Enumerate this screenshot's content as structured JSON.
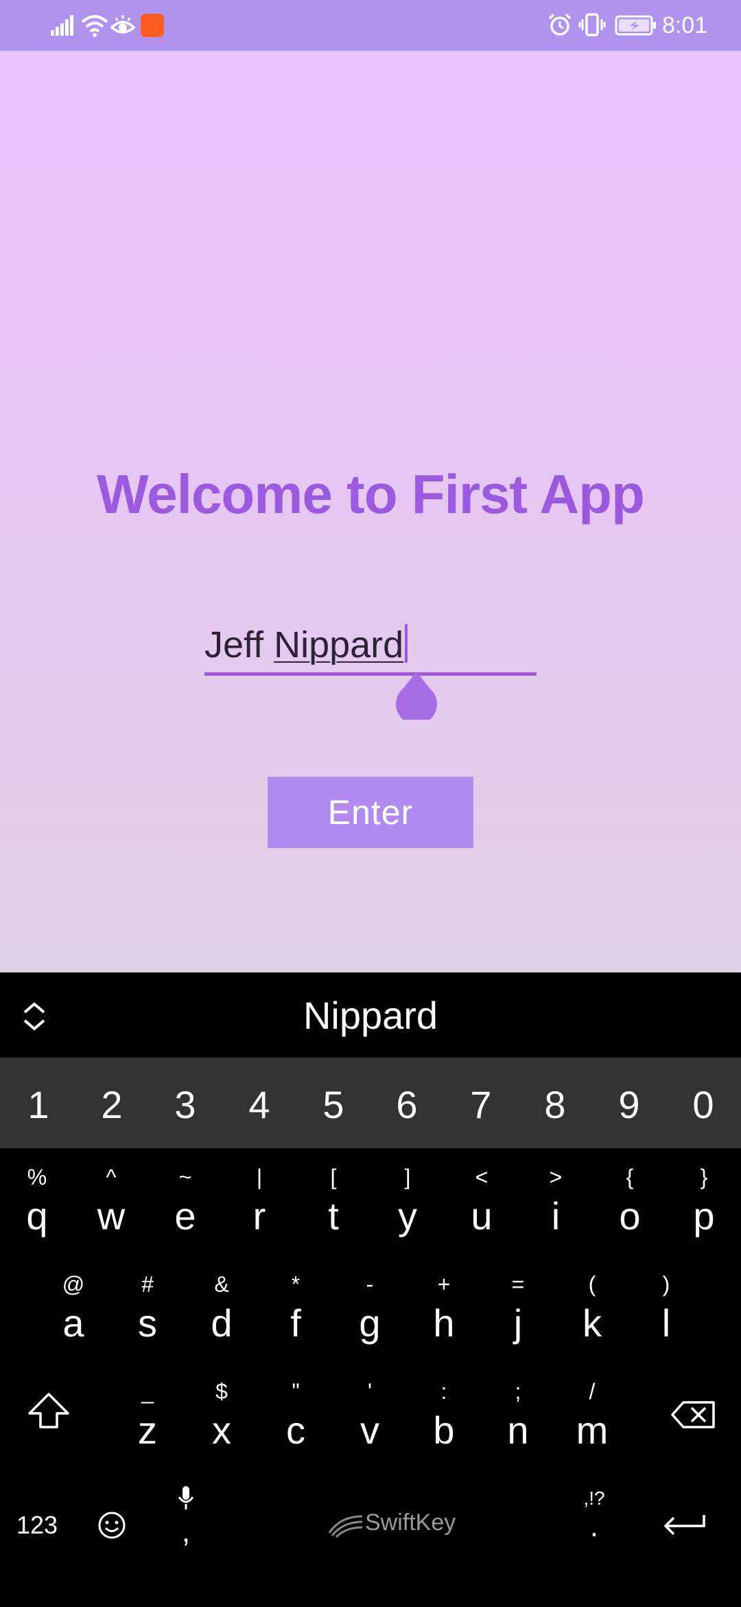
{
  "status_bar": {
    "time": "8:01",
    "icons": [
      "signal-icon",
      "wifi-icon",
      "eye-comfort-icon",
      "notification-app-icon",
      "alarm-icon",
      "vibrate-icon",
      "battery-charging-icon"
    ]
  },
  "app": {
    "title": "Welcome to First App",
    "name_input": {
      "value_first": "Jeff ",
      "value_last": "Nippard"
    },
    "enter_button": "Enter",
    "accent_color": "#9a5ae0",
    "button_color": "#b08cf2"
  },
  "keyboard": {
    "suggestion": "Nippard",
    "numbers": [
      "1",
      "2",
      "3",
      "4",
      "5",
      "6",
      "7",
      "8",
      "9",
      "0"
    ],
    "row1": [
      {
        "key": "q",
        "alt": "%"
      },
      {
        "key": "w",
        "alt": "^"
      },
      {
        "key": "e",
        "alt": "~"
      },
      {
        "key": "r",
        "alt": "|"
      },
      {
        "key": "t",
        "alt": "["
      },
      {
        "key": "y",
        "alt": "]"
      },
      {
        "key": "u",
        "alt": "<"
      },
      {
        "key": "i",
        "alt": ">"
      },
      {
        "key": "o",
        "alt": "{"
      },
      {
        "key": "p",
        "alt": "}"
      }
    ],
    "row2": [
      {
        "key": "a",
        "alt": "@"
      },
      {
        "key": "s",
        "alt": "#"
      },
      {
        "key": "d",
        "alt": "&"
      },
      {
        "key": "f",
        "alt": "*"
      },
      {
        "key": "g",
        "alt": "-"
      },
      {
        "key": "h",
        "alt": "+"
      },
      {
        "key": "j",
        "alt": "="
      },
      {
        "key": "k",
        "alt": "("
      },
      {
        "key": "l",
        "alt": ")"
      }
    ],
    "row3": [
      {
        "key": "z",
        "alt": "_"
      },
      {
        "key": "x",
        "alt": "$"
      },
      {
        "key": "c",
        "alt": "\""
      },
      {
        "key": "v",
        "alt": "'"
      },
      {
        "key": "b",
        "alt": ":"
      },
      {
        "key": "n",
        "alt": ";"
      },
      {
        "key": "m",
        "alt": "/"
      }
    ],
    "bottom": {
      "numbers_key": "123",
      "comma_key": ",",
      "brand": "SwiftKey",
      "punct_alt": ",!?",
      "period_key": "."
    }
  }
}
